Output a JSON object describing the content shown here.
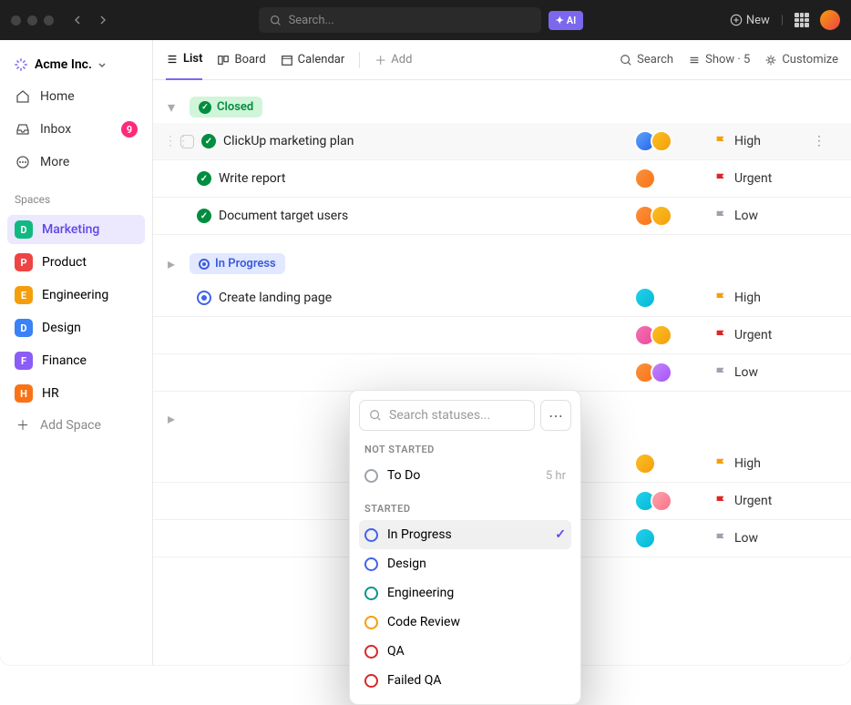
{
  "titlebar": {
    "search_placeholder": "Search...",
    "ai_label": "AI",
    "new_label": "New"
  },
  "workspace": {
    "name": "Acme Inc."
  },
  "nav": {
    "home": "Home",
    "inbox": "Inbox",
    "inbox_count": "9",
    "more": "More"
  },
  "spaces": {
    "label": "Spaces",
    "items": [
      {
        "initial": "D",
        "label": "Marketing",
        "color": "#10b981"
      },
      {
        "initial": "P",
        "label": "Product",
        "color": "#ef4444"
      },
      {
        "initial": "E",
        "label": "Engineering",
        "color": "#f59e0b"
      },
      {
        "initial": "D",
        "label": "Design",
        "color": "#3b82f6"
      },
      {
        "initial": "F",
        "label": "Finance",
        "color": "#8b5cf6"
      },
      {
        "initial": "H",
        "label": "HR",
        "color": "#f97316"
      }
    ],
    "add_label": "Add Space"
  },
  "views": {
    "list": "List",
    "board": "Board",
    "calendar": "Calendar",
    "add": "Add"
  },
  "toolbar": {
    "search": "Search",
    "show": "Show · 5",
    "customize": "Customize"
  },
  "groups": {
    "closed": "Closed",
    "in_progress": "In Progress"
  },
  "tasks": {
    "t1": "ClickUp marketing plan",
    "t2": "Write report",
    "t3": "Document target users",
    "t4": "Create landing page"
  },
  "priority": {
    "high": "High",
    "urgent": "Urgent",
    "low": "Low"
  },
  "popover": {
    "search_placeholder": "Search statuses...",
    "section_not_started": "NOT STARTED",
    "section_started": "STARTED",
    "todo": "To Do",
    "todo_time": "5 hr",
    "in_progress": "In Progress",
    "design": "Design",
    "engineering": "Engineering",
    "code_review": "Code Review",
    "qa": "QA",
    "failed_qa": "Failed QA"
  },
  "avatars": {
    "a1": "linear-gradient(135deg,#60a5fa,#2563eb)",
    "a2": "linear-gradient(135deg,#fbbf24,#f59e0b)",
    "a3": "linear-gradient(135deg,#fb923c,#f97316)",
    "a4": "linear-gradient(135deg,#c084fc,#a855f7)",
    "a5": "linear-gradient(135deg,#f472b6,#ec4899)",
    "a6": "linear-gradient(135deg,#34d399,#10b981)",
    "a7": "linear-gradient(135deg,#22d3ee,#06b6d4)"
  }
}
